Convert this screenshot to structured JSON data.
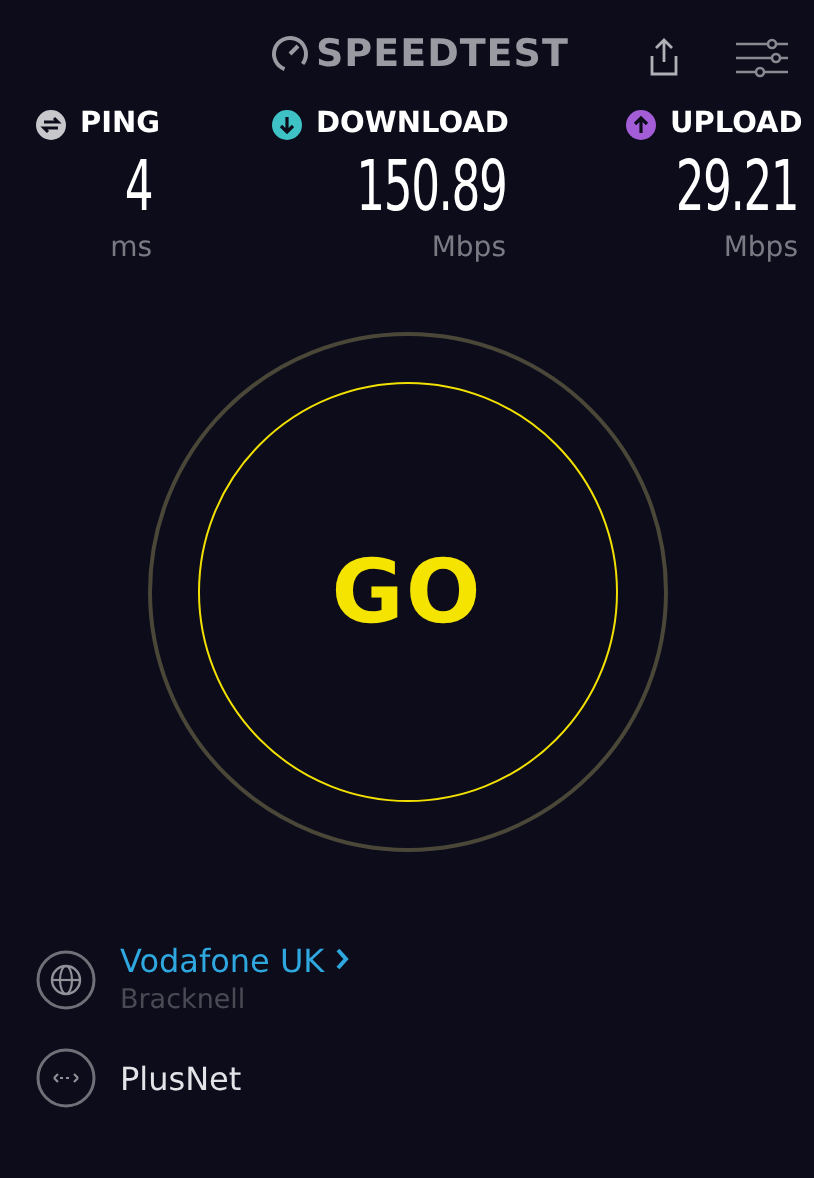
{
  "header": {
    "logo": "SPEEDTEST"
  },
  "metrics": [
    {
      "label": "PING",
      "value": "4",
      "unit": "ms",
      "color": "#c8c8cc",
      "kind": "ping"
    },
    {
      "label": "DOWNLOAD",
      "value": "150.89",
      "unit": "Mbps",
      "color": "#3fc2c6",
      "kind": "download"
    },
    {
      "label": "UPLOAD",
      "value": "29.21",
      "unit": "Mbps",
      "color": "#a35dd6",
      "kind": "upload"
    }
  ],
  "go_button": {
    "label": "GO"
  },
  "servers": [
    {
      "kind": "isp",
      "name": "Vodafone UK",
      "location": "Bracknell"
    },
    {
      "kind": "connection",
      "name": "PlusNet"
    }
  ]
}
